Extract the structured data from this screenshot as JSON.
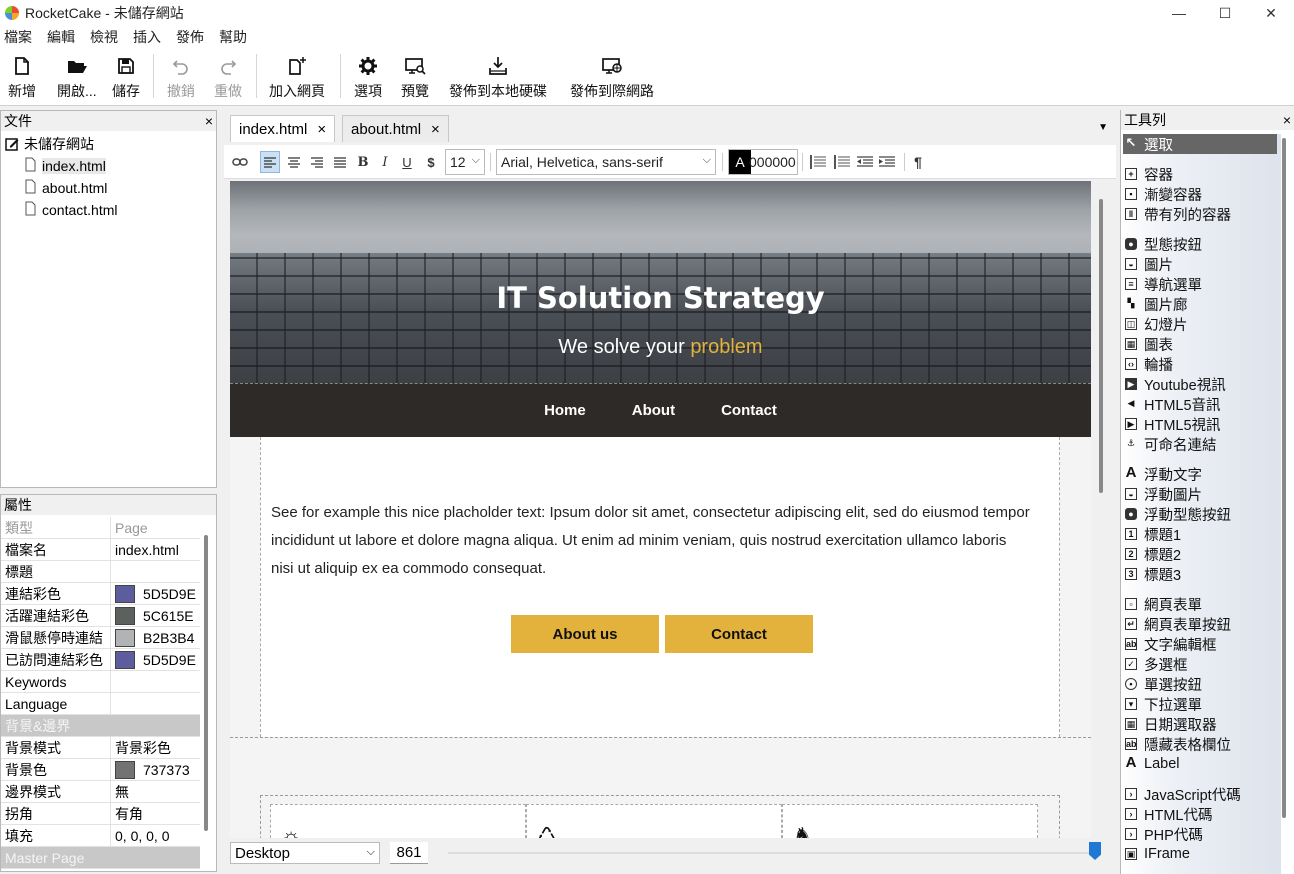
{
  "window": {
    "title": "RocketCake - 未儲存網站",
    "minimize": "—",
    "maximize": "☐",
    "close": "✕"
  },
  "menu": [
    "檔案",
    "編輯",
    "檢視",
    "插入",
    "發佈",
    "幫助"
  ],
  "toolbar": {
    "new": "新增",
    "open": "開啟...",
    "save": "儲存",
    "undo": "撤銷",
    "redo": "重做",
    "add_page": "加入網頁",
    "options": "選項",
    "preview": "預覽",
    "publish_local": "發佈到本地硬碟",
    "publish_web": "發佈到際網路"
  },
  "files_panel": {
    "title": "文件",
    "close": "×",
    "root": "未儲存網站",
    "files": [
      "index.html",
      "about.html",
      "contact.html"
    ]
  },
  "props_panel": {
    "title": "屬性",
    "header": {
      "key": "類型",
      "value": "Page"
    },
    "rows": [
      {
        "key": "檔案名",
        "value": "index.html"
      },
      {
        "key": "標題",
        "value": ""
      },
      {
        "key": "連結彩色",
        "value": "5D5D9E",
        "color": "#5D5D9E"
      },
      {
        "key": "活躍連結彩色",
        "value": "5C615E",
        "color": "#5C615E"
      },
      {
        "key": "滑鼠懸停時連結",
        "value": "B2B3B4",
        "color": "#B2B3B4"
      },
      {
        "key": "已訪問連結彩色",
        "value": "5D5D9E",
        "color": "#5D5D9E"
      },
      {
        "key": "Keywords",
        "value": ""
      },
      {
        "key": "Language",
        "value": ""
      }
    ],
    "section_bg": "背景&邊界",
    "rows2": [
      {
        "key": "背景模式",
        "value": "背景彩色"
      },
      {
        "key": "背景色",
        "value": "737373",
        "color": "#737373"
      },
      {
        "key": "邊界模式",
        "value": "無"
      },
      {
        "key": "拐角",
        "value": "有角"
      },
      {
        "key": "填充",
        "value": "0, 0, 0, 0"
      }
    ],
    "section_master": "Master Page"
  },
  "editor": {
    "tabs": [
      {
        "label": "index.html",
        "close": "×"
      },
      {
        "label": "about.html",
        "close": "×"
      }
    ],
    "tabs_menu": "▼",
    "format": {
      "font_size": "12",
      "font_family": "Arial, Helvetica, sans-serif",
      "color_value": "000000",
      "bold": "B",
      "italic": "I",
      "underline": "U",
      "dollar": "$",
      "pilcrow": "¶",
      "color_letter": "A"
    }
  },
  "page": {
    "hero_title": "IT Solution Strategy",
    "hero_sub_prefix": "We solve your ",
    "hero_sub_highlight": "problem",
    "nav": [
      "Home",
      "About",
      "Contact"
    ],
    "body_text": "See for example this nice placholder text: Ipsum dolor sit amet, consectetur adipiscing elit, sed do eiusmod tempor incididunt ut labore et dolore magna aliqua. Ut enim ad minim veniam, quis nostrud exercitation ullamco laboris nisi ut aliquip ex ea commodo consequat.",
    "button_about": "About us",
    "button_contact": "Contact",
    "accent_color": "#E3B23C"
  },
  "editor_bottom": {
    "device": "Desktop",
    "width": "861"
  },
  "toolbox": {
    "title": "工具列",
    "close": "×",
    "selected": "選取",
    "groups": [
      [
        "容器",
        "漸變容器",
        "帶有列的容器"
      ],
      [
        "型態按鈕",
        "圖片",
        "導航選單",
        "圖片廊",
        "幻燈片",
        "圖表",
        "輪播",
        "Youtube視訊",
        "HTML5音訊",
        "HTML5視訊",
        "可命名連結"
      ],
      [
        "浮動文字",
        "浮動圖片",
        "浮動型態按鈕",
        "標題1",
        "標題2",
        "標題3"
      ],
      [
        "網頁表單",
        "網頁表單按鈕",
        "文字編輯框",
        "多選框",
        "單選按鈕",
        "下拉選單",
        "日期選取器",
        "隱藏表格欄位",
        "Label"
      ],
      [
        "JavaScript代碼",
        "HTML代碼",
        "PHP代碼",
        "IFrame"
      ]
    ]
  }
}
